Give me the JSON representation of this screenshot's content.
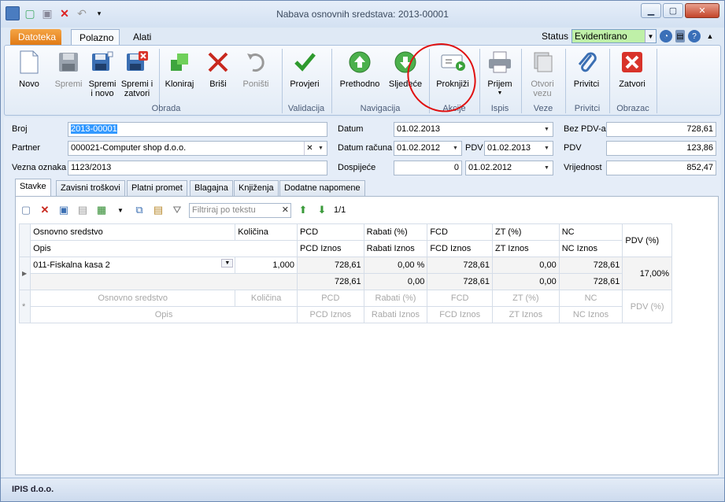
{
  "window": {
    "title": "Nabava osnovnih sredstava: 2013-00001"
  },
  "ribbon_tabs": {
    "file": "Datoteka",
    "home": "Polazno",
    "tools": "Alati"
  },
  "status": {
    "label": "Status",
    "value": "Evidentirano"
  },
  "ribbon": {
    "buttons": {
      "novo": "Novo",
      "spremi": "Spremi",
      "spremi_novo": "Spremi\ni novo",
      "spremi_zatvori": "Spremi i\nzatvori",
      "kloniraj": "Kloniraj",
      "brisi": "Briši",
      "ponisti": "Poništi",
      "provjeri": "Provjeri",
      "prethodno": "Prethodno",
      "sljedece": "Sljedeće",
      "proknjizi": "Proknjiži",
      "prijem": "Prijem",
      "otvori_vezu": "Otvori\nvezu",
      "privitci": "Privitci",
      "zatvori": "Zatvori"
    },
    "groups": {
      "obrada": "Obrada",
      "validacija": "Validacija",
      "navigacija": "Navigacija",
      "akcije": "Akcije",
      "ispis": "Ispis",
      "veze": "Veze",
      "privitci": "Privitci",
      "obrazac": "Obrazac"
    }
  },
  "form": {
    "broj_label": "Broj",
    "broj": "2013-00001",
    "partner_label": "Partner",
    "partner": "000021-Computer shop d.o.o.",
    "vezna_label": "Vezna oznaka",
    "vezna": "1123/2013",
    "datum_label": "Datum",
    "datum": "01.02.2013",
    "datum_racuna_label": "Datum računa",
    "datum_racuna": "01.02.2012",
    "pdv_date_label": "PDV",
    "pdv_date": "01.02.2013",
    "dospijece_label": "Dospijeće",
    "dospijece_days": "0",
    "dospijece": "01.02.2012",
    "bez_pdv_label": "Bez PDV-a",
    "bez_pdv": "728,61",
    "pdv_label": "PDV",
    "pdv": "123,86",
    "vrijednost_label": "Vrijednost",
    "vrijednost": "852,47"
  },
  "inner_tabs": [
    "Stavke",
    "Zavisni troškovi",
    "Platni promet",
    "Blagajna",
    "Knjiženja",
    "Dodatne napomene"
  ],
  "toolbar": {
    "filter_placeholder": "Filtriraj po tekstu",
    "pager": "1/1"
  },
  "grid": {
    "headers": {
      "osnovno": "Osnovno sredstvo",
      "kolicina": "Količina",
      "pcd": "PCD",
      "rabati": "Rabati (%)",
      "fcd": "FCD",
      "zt": "ZT (%)",
      "nc": "NC",
      "pdv": "PDV (%)",
      "opis": "Opis",
      "pcd_iznos": "PCD Iznos",
      "rabati_iznos": "Rabati Iznos",
      "fcd_iznos": "FCD Iznos",
      "zt_iznos": "ZT Iznos",
      "nc_iznos": "NC Iznos"
    },
    "row": {
      "osnovno": "011-Fiskalna kasa 2",
      "kolicina": "1,000",
      "pcd": "728,61",
      "rabati": "0,00 %",
      "fcd": "728,61",
      "zt": "0,00",
      "nc": "728,61",
      "pdv": "17,00%",
      "pcd_iznos": "728,61",
      "rabati_iznos": "0,00",
      "fcd_iznos": "728,61",
      "zt_iznos": "0,00",
      "nc_iznos": "728,61"
    }
  },
  "statusbar": {
    "company": "IPIS d.o.o."
  }
}
